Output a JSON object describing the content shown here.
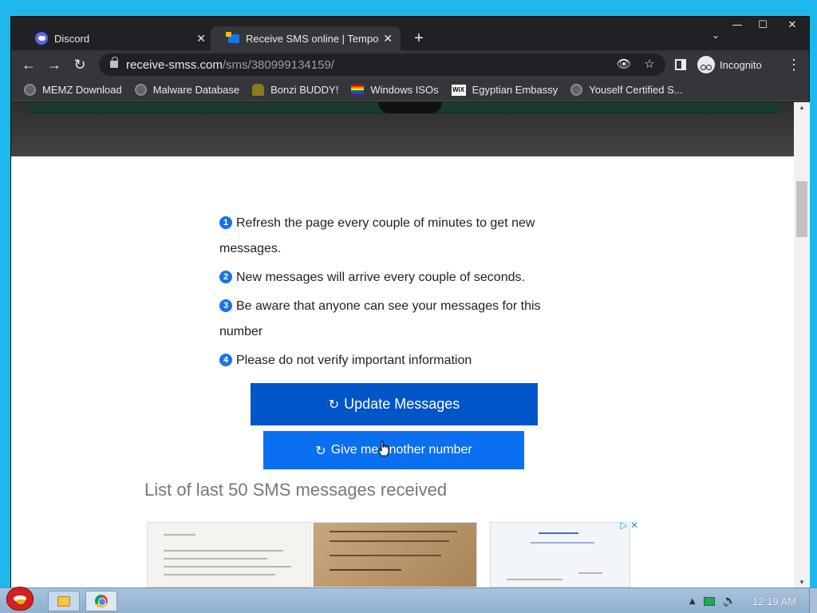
{
  "window": {
    "controls": {
      "minimize": "—",
      "maximize": "☐",
      "close": "✕"
    }
  },
  "tabs": [
    {
      "title": "Discord",
      "icon": "discord-icon",
      "close": "✕"
    },
    {
      "title": "Receive SMS online | Temporary",
      "icon": "sms-site-icon",
      "close": "✕"
    }
  ],
  "tabstrip": {
    "new_tab": "+",
    "tab_search": "⌄"
  },
  "toolbar": {
    "back": "←",
    "forward": "→",
    "reload": "↻",
    "url_host": "receive-smss.com",
    "url_path": "/sms/380999134159/",
    "eye_off": "👁",
    "bookmark_star": "☆",
    "incognito_label": "Incognito",
    "menu": "⋮"
  },
  "bookmarks": [
    {
      "label": "MEMZ Download",
      "icon": "globe-icon"
    },
    {
      "label": "Malware Database",
      "icon": "globe-icon"
    },
    {
      "label": "Bonzi BUDDY!",
      "icon": "bonzi-icon"
    },
    {
      "label": "Windows ISOs",
      "icon": "rainbow-icon"
    },
    {
      "label": "Egyptian Embassy",
      "icon": "wix-icon",
      "icon_text": "WiX"
    },
    {
      "label": "Youself Certified S...",
      "icon": "globe-icon"
    }
  ],
  "page": {
    "instructions": [
      {
        "num": "1",
        "text": "Refresh the page every couple of minutes to get new messages."
      },
      {
        "num": "2",
        "text": "New messages will arrive every couple of seconds."
      },
      {
        "num": "3",
        "text": "Be aware that anyone can see your messages for this number"
      },
      {
        "num": "4",
        "text": "Please do not verify important information"
      }
    ],
    "update_button": "Update Messages",
    "another_button": "Give me another number",
    "refresh_glyph": "↻",
    "list_heading": "List of last 50 SMS messages received",
    "ad_choice": "▷ ✕"
  },
  "scrollbar": {
    "up": "▲",
    "down": "▼",
    "thumb_position": 0.17
  },
  "taskbar": {
    "clock": "12:19 AM",
    "tray": {
      "up_arrow": "▲",
      "volume": "🔊"
    }
  },
  "colors": {
    "primary_button": "#0055c8",
    "secondary_button": "#0a6ff0",
    "badge": "#1a73e8",
    "browser_dark": "#202124",
    "desktop": "#1fb8ec"
  }
}
